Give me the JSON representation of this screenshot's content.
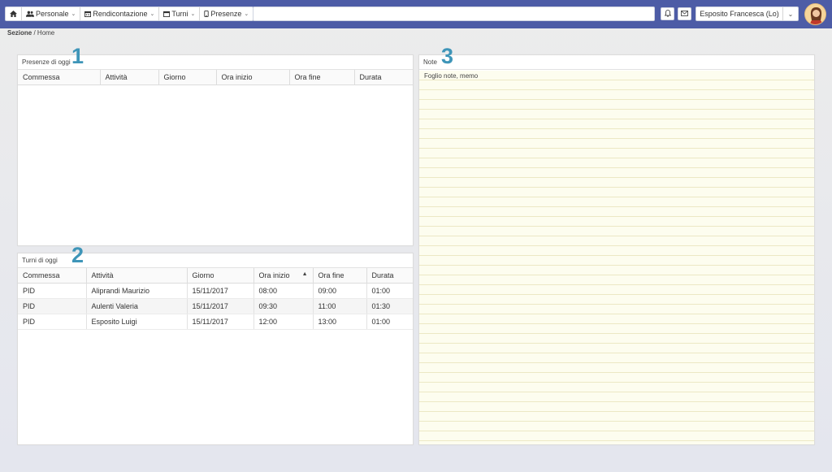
{
  "nav": {
    "home_icon": "home-icon",
    "items": [
      {
        "label": "Personale",
        "icon": "users-icon"
      },
      {
        "label": "Rendicontazione",
        "icon": "calendar-icon"
      },
      {
        "label": "Turni",
        "icon": "calendar-icon"
      },
      {
        "label": "Presenze",
        "icon": "phone-icon"
      }
    ]
  },
  "header": {
    "search_value": "",
    "bell_icon": "bell-icon",
    "mail_icon": "mail-icon",
    "user_name": "Esposito Francesca (Lo)",
    "accent_color": "#4d5ca6"
  },
  "breadcrumb": {
    "section": "Sezione",
    "page": "/ Home"
  },
  "presenze": {
    "title": "Presenze di oggi",
    "number": "1",
    "columns": [
      "Commessa",
      "Attività",
      "Giorno",
      "Ora inizio",
      "Ora fine",
      "Durata"
    ],
    "rows": []
  },
  "turni": {
    "title": "Turni di oggi",
    "number": "2",
    "columns": [
      "Commessa",
      "Attività",
      "Giorno",
      "Ora inizio",
      "Ora fine",
      "Durata"
    ],
    "rows": [
      [
        "PID",
        "Aliprandi Maurizio",
        "15/11/2017",
        "08:00",
        "09:00",
        "01:00"
      ],
      [
        "PID",
        "Aulenti Valeria",
        "15/11/2017",
        "09:30",
        "11:00",
        "01:30"
      ],
      [
        "PID",
        "Esposito Luigi",
        "15/11/2017",
        "12:00",
        "13:00",
        "01:00"
      ]
    ]
  },
  "note": {
    "title": "Note",
    "number": "3",
    "placeholder": "Foglio note, memo"
  }
}
